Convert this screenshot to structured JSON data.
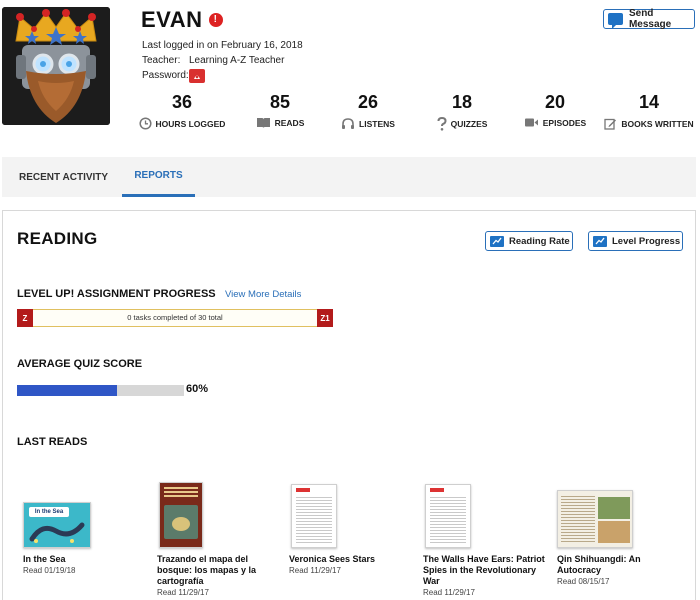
{
  "profile": {
    "name": "EVAN",
    "last_logged": "Last logged in on February 16, 2018",
    "teacher_label": "Teacher:",
    "teacher_value": "Learning A-Z Teacher",
    "password_label": "Password:"
  },
  "header": {
    "send_message_label": "Send Message"
  },
  "stats": [
    {
      "value": "36",
      "label": "HOURS LOGGED",
      "icon": "clock-icon"
    },
    {
      "value": "85",
      "label": "READS",
      "icon": "book-icon"
    },
    {
      "value": "26",
      "label": "LISTENS",
      "icon": "headphones-icon"
    },
    {
      "value": "18",
      "label": "QUIZZES",
      "icon": "question-icon"
    },
    {
      "value": "20",
      "label": "EPISODES",
      "icon": "video-icon"
    },
    {
      "value": "14",
      "label": "BOOKS WRITTEN",
      "icon": "pencil-icon"
    }
  ],
  "tabs": [
    {
      "label": "RECENT ACTIVITY",
      "active": false
    },
    {
      "label": "REPORTS",
      "active": true
    }
  ],
  "reading": {
    "title": "READING",
    "reading_rate_label": "Reading Rate",
    "level_progress_label": "Level Progress",
    "levelup_title": "LEVEL UP! ASSIGNMENT PROGRESS",
    "view_more_label": "View More Details",
    "progress_text": "0 tasks completed of 30 total",
    "progress_fraction": 0,
    "level_start": "Z",
    "level_end": "Z1",
    "quiz_title": "AVERAGE QUIZ SCORE",
    "quiz_percent_label": "60%",
    "quiz_percent": 60,
    "last_reads_title": "LAST READS"
  },
  "last_reads": [
    {
      "title": "In the Sea",
      "date": "Read 01/19/18",
      "cover_text": "In the Sea"
    },
    {
      "title": "Trazando el mapa del bosque: los mapas y la cartografía",
      "date": "Read 11/29/17"
    },
    {
      "title": "Veronica Sees Stars",
      "date": "Read 11/29/17"
    },
    {
      "title": "The Walls Have Ears: Patriot Spies in the Revolutionary War",
      "date": "Read 11/29/17"
    },
    {
      "title": "Qin Shihuangdi: An Autocracy",
      "date": "Read 08/15/17"
    }
  ],
  "colors": {
    "accent": "#2a6fb8",
    "level_badge": "#b31b1b",
    "quiz_fill": "#2f56c6",
    "alert": "#dd2222"
  }
}
